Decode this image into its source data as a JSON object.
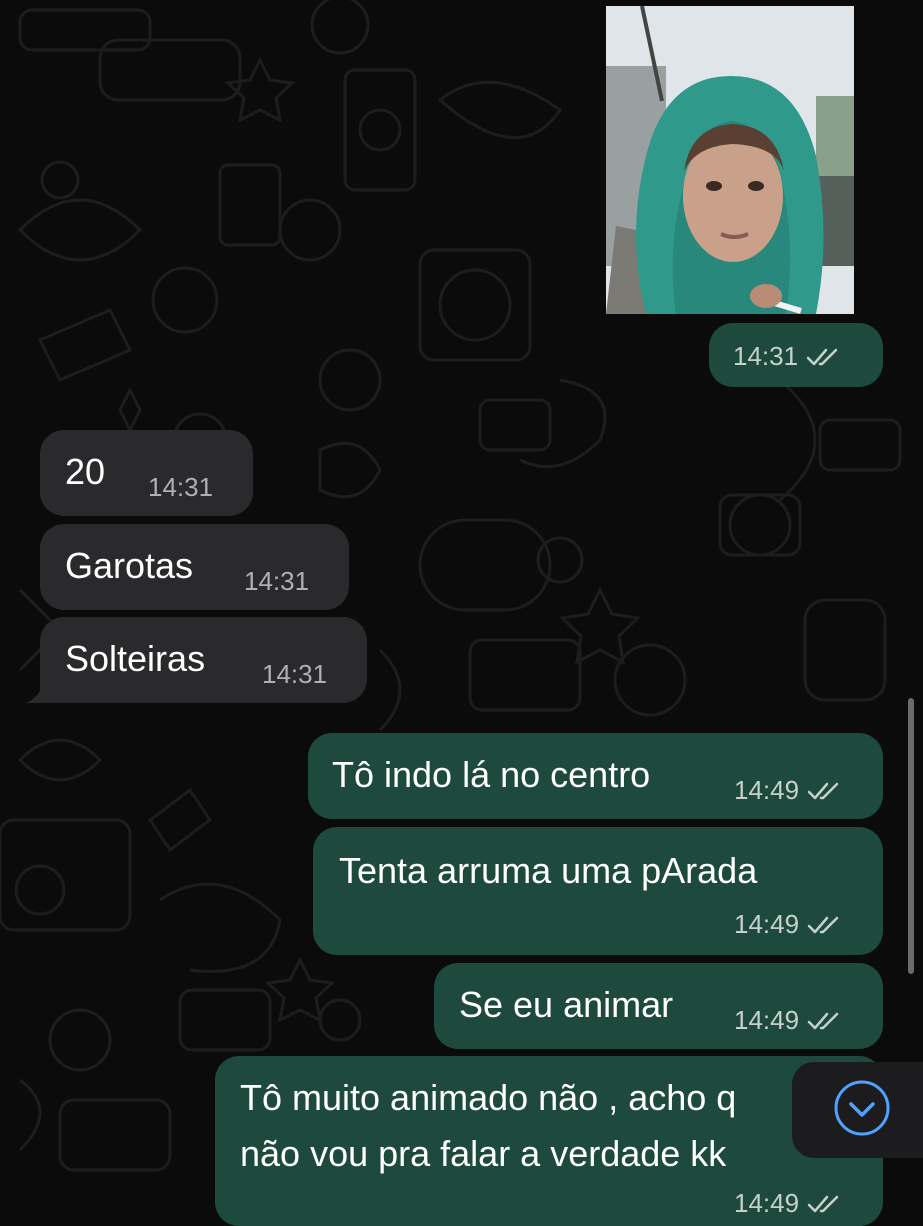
{
  "chat": {
    "messages": [
      {
        "type": "image",
        "direction": "outgoing",
        "time": "14:31",
        "status": "read"
      },
      {
        "type": "text",
        "direction": "incoming",
        "text": "20",
        "time": "14:31"
      },
      {
        "type": "text",
        "direction": "incoming",
        "text": "Garotas",
        "time": "14:31"
      },
      {
        "type": "text",
        "direction": "incoming",
        "text": "Solteiras",
        "time": "14:31"
      },
      {
        "type": "text",
        "direction": "outgoing",
        "text": "Tô indo lá no centro",
        "time": "14:49",
        "status": "read"
      },
      {
        "type": "text",
        "direction": "outgoing",
        "text": "Tenta arruma uma pArada",
        "time": "14:49",
        "status": "read"
      },
      {
        "type": "text",
        "direction": "outgoing",
        "text": "Se eu animar",
        "time": "14:49",
        "status": "read"
      },
      {
        "type": "text",
        "direction": "outgoing",
        "text_line1": "Tô muito animado não , acho q",
        "text_line2": "não vou pra falar a verdade kk",
        "time": "14:49",
        "status": "read"
      }
    ]
  },
  "controls": {
    "scroll_down_icon": "chevron-down-circle-icon"
  },
  "colors": {
    "background": "#0b0b0b",
    "outgoing_bubble": "#1e4a3e",
    "incoming_bubble": "#2a2a2c",
    "accent": "#4fa3ff"
  }
}
